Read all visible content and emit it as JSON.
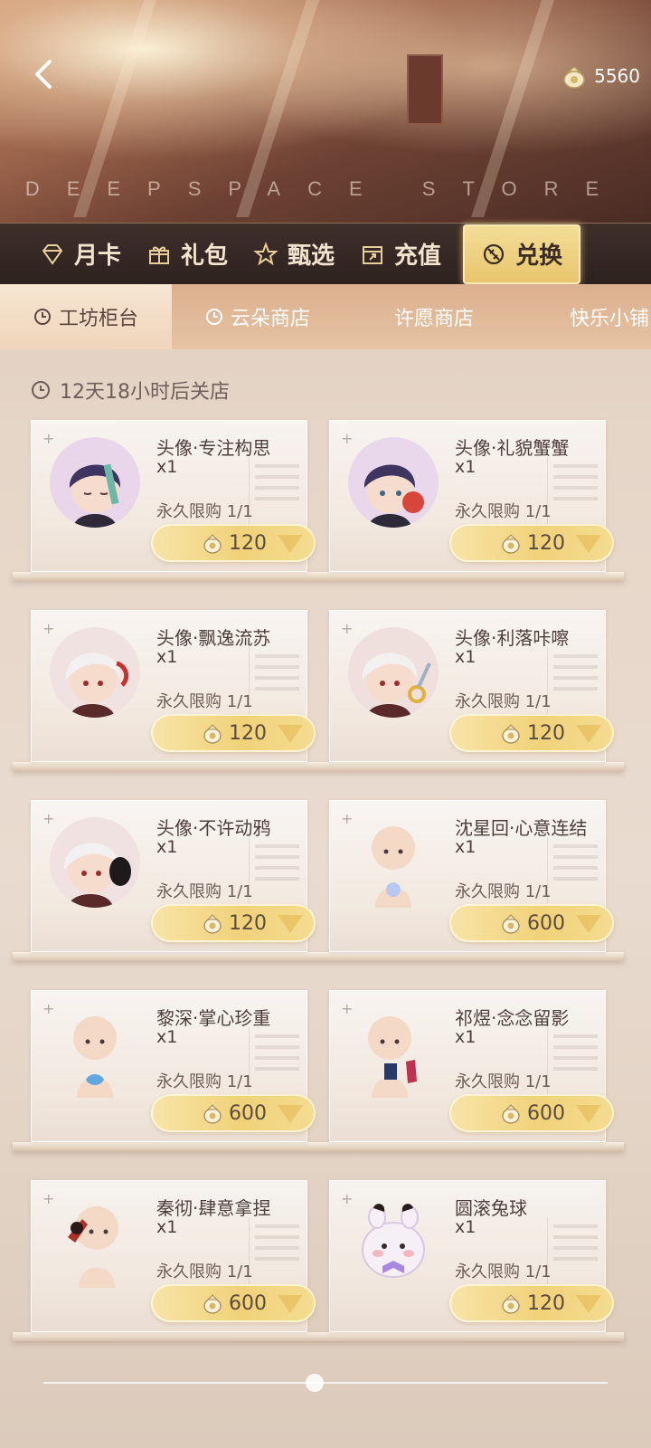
{
  "header": {
    "store_title": "DEEPSPACE STORE",
    "currency_amount": "5560"
  },
  "main_nav": [
    {
      "label": "月卡",
      "icon": "diamond-icon"
    },
    {
      "label": "礼包",
      "icon": "gift-icon"
    },
    {
      "label": "甄选",
      "icon": "star-icon"
    },
    {
      "label": "充值",
      "icon": "recharge-icon"
    },
    {
      "label": "兑换",
      "icon": "exchange-icon",
      "active": true
    }
  ],
  "sub_tabs": [
    {
      "label": "工坊柜台",
      "icon": "clock-icon",
      "active": true
    },
    {
      "label": "云朵商店",
      "icon": "clock-icon"
    },
    {
      "label": "许愿商店"
    },
    {
      "label": "快乐小铺"
    }
  ],
  "timer_text": "12天18小时后关店",
  "products": [
    {
      "name": "头像·专注构思",
      "qty": "x1",
      "limit": "永久限购 1/1",
      "price": "120"
    },
    {
      "name": "头像·礼貌蟹蟹",
      "qty": "x1",
      "limit": "永久限购 1/1",
      "price": "120"
    },
    {
      "name": "头像·飘逸流苏",
      "qty": "x1",
      "limit": "永久限购 1/1",
      "price": "120"
    },
    {
      "name": "头像·利落咔嚓",
      "qty": "x1",
      "limit": "永久限购 1/1",
      "price": "120"
    },
    {
      "name": "头像·不许动鸦",
      "qty": "x1",
      "limit": "永久限购 1/1",
      "price": "120"
    },
    {
      "name": "沈星回·心意连结",
      "qty": "x1",
      "limit": "永久限购 1/1",
      "price": "600"
    },
    {
      "name": "黎深·掌心珍重",
      "qty": "x1",
      "limit": "永久限购 1/1",
      "price": "600"
    },
    {
      "name": "祁煜·念念留影",
      "qty": "x1",
      "limit": "永久限购 1/1",
      "price": "600"
    },
    {
      "name": "秦彻·肆意拿捏",
      "qty": "x1",
      "limit": "永久限购 1/1",
      "price": "600"
    },
    {
      "name": "圆滚兔球",
      "qty": "x1",
      "limit": "永久限购 1/1",
      "price": "120"
    }
  ],
  "colors": {
    "nav_bg": "#2c211e",
    "nav_active": "#e8c46a",
    "price_button": "#f1d27a",
    "sub_tab_bg": "#dbb08e"
  }
}
